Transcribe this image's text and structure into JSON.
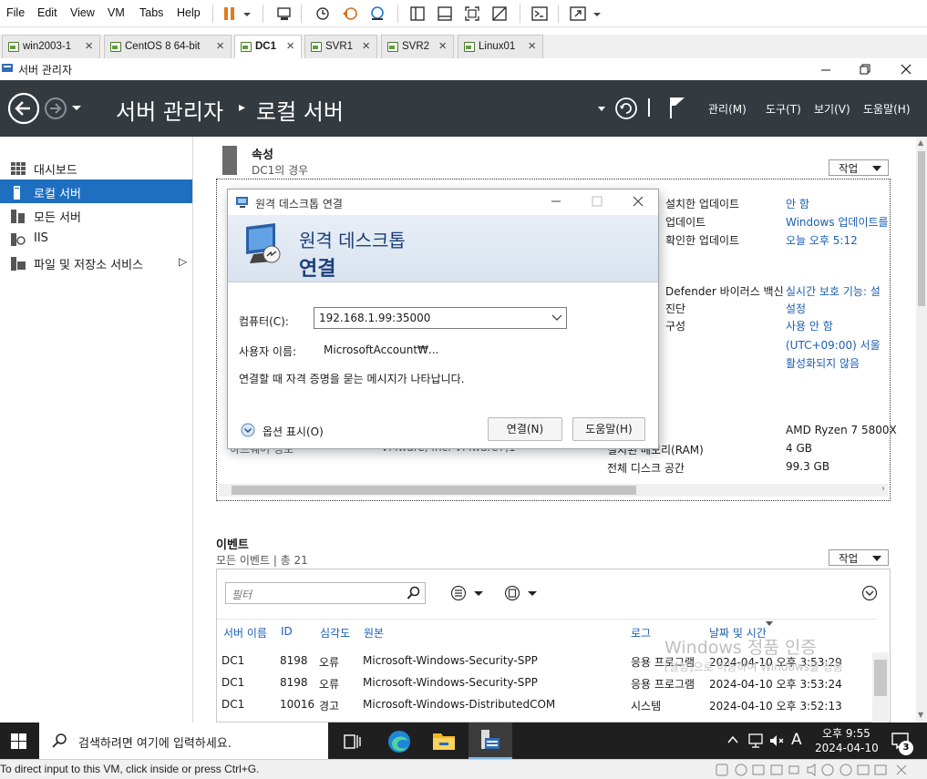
{
  "vmware": {
    "menu": [
      "File",
      "Edit",
      "View",
      "VM",
      "Tabs",
      "Help"
    ],
    "tabs": [
      {
        "label": "win2003-1",
        "active": false
      },
      {
        "label": "CentOS 8 64-bit",
        "active": false
      },
      {
        "label": "DC1",
        "active": true
      },
      {
        "label": "SVR1",
        "active": false
      },
      {
        "label": "SVR2",
        "active": false
      },
      {
        "label": "Linux01",
        "active": false
      }
    ],
    "status_text": "To direct input to this VM, click inside or press Ctrl+G."
  },
  "window": {
    "title": "서버 관리자"
  },
  "header": {
    "breadcrumb_root": "서버 관리자",
    "breadcrumb_sep": "▸",
    "breadcrumb_current": "로컬 서버",
    "menus": [
      "관리(M)",
      "도구(T)",
      "보기(V)",
      "도움말(H)"
    ]
  },
  "nav": {
    "items": [
      {
        "label": "대시보드",
        "icon": "dashboard-icon"
      },
      {
        "label": "로컬 서버",
        "icon": "local-server-icon",
        "active": true
      },
      {
        "label": "모든 서버",
        "icon": "all-servers-icon"
      },
      {
        "label": "IIS",
        "icon": "iis-icon"
      },
      {
        "label": "파일 및 저장소 서비스",
        "icon": "file-storage-icon",
        "expand": "▷"
      }
    ]
  },
  "properties": {
    "title": "속성",
    "subtitle": "DC1의 경우",
    "task_label": "작업",
    "rows_right": [
      {
        "label": "설치한 업데이트",
        "value": "안 함"
      },
      {
        "label": "업데이트",
        "value": "Windows 업데이트를"
      },
      {
        "label": "확인한 업데이트",
        "value": "오늘 오후 5:12"
      },
      {
        "label": "Defender 바이러스 백신",
        "value": "실시간 보호 기능: 설"
      },
      {
        "label": "진단",
        "value": "설정"
      },
      {
        "label": "구성",
        "value": "사용 안 함"
      },
      {
        "label": "",
        "value": "(UTC+09:00) 서울"
      },
      {
        "label": "",
        "value": "활성화되지 않음"
      }
    ],
    "rows_bottom": [
      {
        "label": "",
        "value": "AMD Ryzen 7 5800X"
      },
      {
        "label": "설치된 메모리(RAM)",
        "value": "4 GB"
      },
      {
        "label": "전체 디스크 공간",
        "value": "99.3 GB"
      }
    ],
    "hidden_left_label": "하드웨어 정보",
    "hidden_left_value": "VMware, Inc. VMware7,1"
  },
  "rdp": {
    "title": "원격 데스크톱 연결",
    "banner_line1": "원격 데스크톱",
    "banner_line2": "연결",
    "computer_label": "컴퓨터(C):",
    "computer_value": "192.168.1.99:35000",
    "user_label": "사용자 이름:",
    "user_value": "MicrosoftAccount₩...",
    "notice": "연결할 때 자격 증명을 묻는 메시지가 나타납니다.",
    "options_label": "옵션 표시(O)",
    "connect_label": "연결(N)",
    "help_label": "도움말(H)"
  },
  "events": {
    "title": "이벤트",
    "subtitle": "모든 이벤트 | 총 21",
    "task_label": "작업",
    "filter_placeholder": "필터",
    "columns": [
      "서버 이름",
      "ID",
      "심각도",
      "원본",
      "로그",
      "날짜 및 시간"
    ],
    "rows": [
      [
        "DC1",
        "8198",
        "오류",
        "Microsoft-Windows-Security-SPP",
        "응용 프로그램",
        "2024-04-10 오후 3:53:29"
      ],
      [
        "DC1",
        "8198",
        "오류",
        "Microsoft-Windows-Security-SPP",
        "응용 프로그램",
        "2024-04-10 오후 3:53:24"
      ],
      [
        "DC1",
        "10016",
        "경고",
        "Microsoft-Windows-DistributedCOM",
        "시스템",
        "2024-04-10 오후 3:52:13"
      ]
    ]
  },
  "watermark": {
    "line1": "Windows 정품 인증",
    "line2": "[설정]으로 이동하여 Windows를 정품"
  },
  "taskbar": {
    "search_placeholder": "검색하려면 여기에 입력하세요.",
    "time": "오후 9:55",
    "date": "2024-04-10",
    "ime": "A",
    "notification_count": "3"
  }
}
